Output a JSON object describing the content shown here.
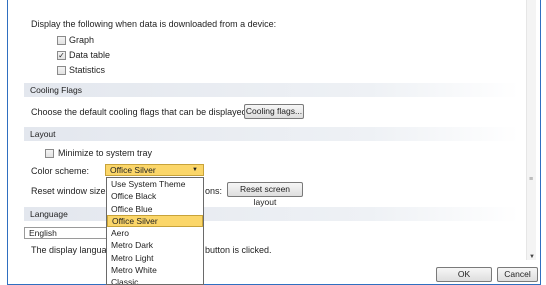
{
  "download": {
    "description": "Display the following when data is downloaded from a device:",
    "options": [
      {
        "label": "Graph",
        "checked": false
      },
      {
        "label": "Data table",
        "checked": true
      },
      {
        "label": "Statistics",
        "checked": false
      }
    ]
  },
  "cooling": {
    "header": "Cooling Flags",
    "description": "Choose the default cooling flags that can be displayed:",
    "button": "Cooling flags..."
  },
  "layout": {
    "header": "Layout",
    "minimize_label": "Minimize to system tray",
    "minimize_checked": false,
    "color_scheme_label": "Color scheme:",
    "color_scheme_value": "Office Silver",
    "color_scheme_options": [
      "Use System Theme",
      "Office Black",
      "Office Blue",
      "Office Silver",
      "Aero",
      "Metro Dark",
      "Metro Light",
      "Metro White",
      "Classic"
    ],
    "reset_label_left": "Reset window size",
    "reset_label_right": "ons:",
    "reset_button": "Reset screen layout"
  },
  "language": {
    "header": "Language",
    "value": "English",
    "note_left": "The display langua",
    "note_right": "button is clicked."
  },
  "footer": {
    "ok": "OK",
    "cancel": "Cancel"
  },
  "icons": {
    "check": "✓",
    "dropdown_arrow": "▼",
    "scroll_down": "▼",
    "grip": "≡"
  }
}
